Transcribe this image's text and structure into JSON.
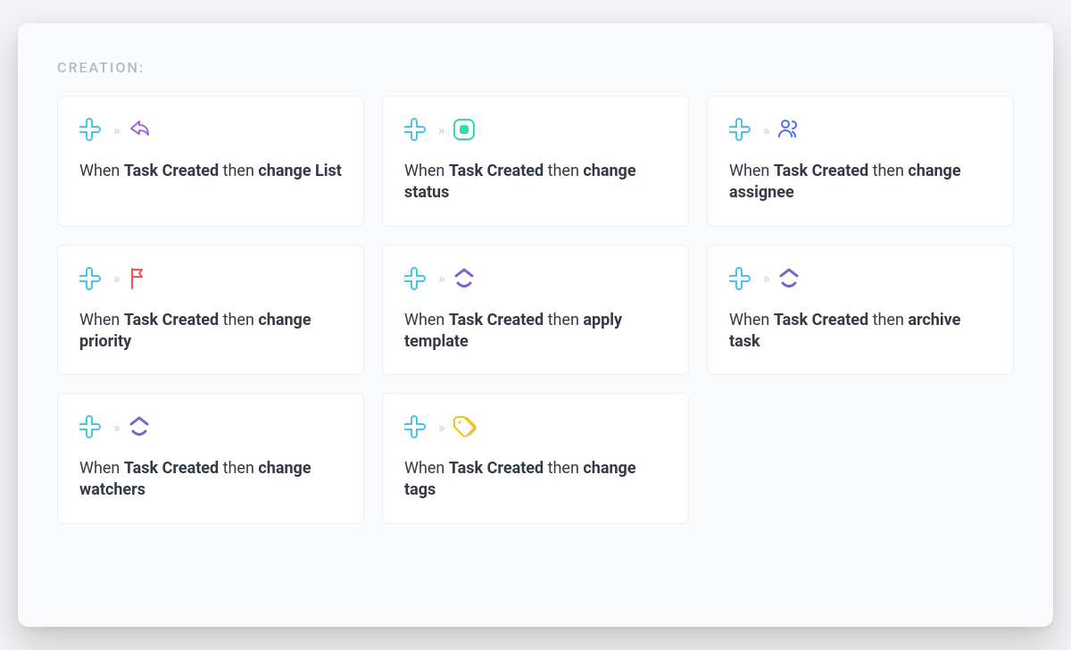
{
  "section_label": "CREATION:",
  "text": {
    "when": "When ",
    "trigger": "Task Created",
    "then": " then "
  },
  "colors": {
    "plus": "#49C3E6",
    "arrow_purple": "#9C6ADE",
    "status_green": "#38D9A9",
    "people_blue": "#4C6EF5",
    "flag_red": "#FA5252",
    "up_purple": "#7B61D0",
    "tag_yellow": "#EEC02A",
    "chevron_gray": "#c9cdd7"
  },
  "cards": [
    {
      "id": "change-list",
      "action": "change List",
      "icon": "share"
    },
    {
      "id": "change-status",
      "action": "change status",
      "icon": "status"
    },
    {
      "id": "change-assignee",
      "action": "change assignee",
      "icon": "people"
    },
    {
      "id": "change-priority",
      "action": "change priority",
      "icon": "flag"
    },
    {
      "id": "apply-template",
      "action": "apply template",
      "icon": "clickup"
    },
    {
      "id": "archive-task",
      "action": "archive task",
      "icon": "clickup"
    },
    {
      "id": "change-watchers",
      "action": "change watchers",
      "icon": "clickup"
    },
    {
      "id": "change-tags",
      "action": "change tags",
      "icon": "tag"
    }
  ]
}
